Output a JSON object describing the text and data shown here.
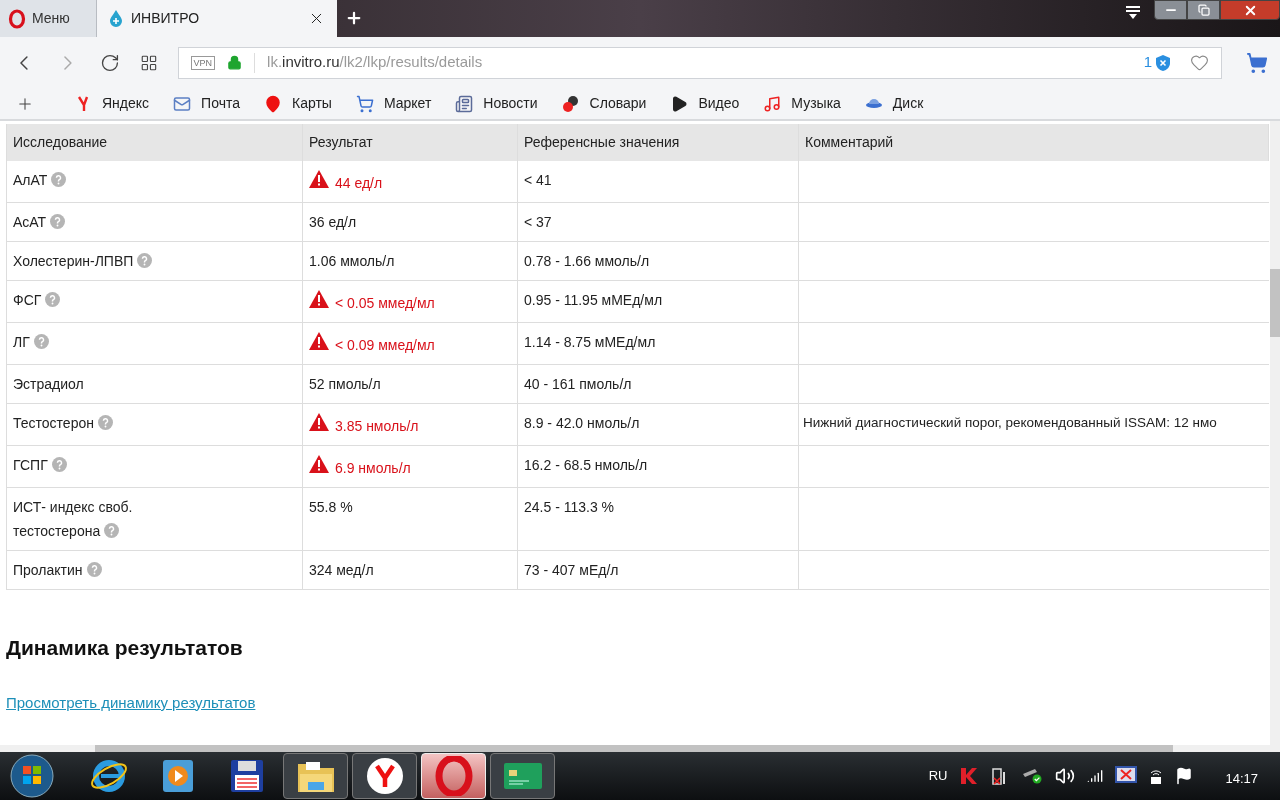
{
  "browser": {
    "menu_label": "Меню",
    "tabs": [
      {
        "title": "ИНВИТРО",
        "selected": true
      }
    ],
    "url": {
      "prefix": "lk.",
      "host": "invitro.ru",
      "path": "/lk2/lkp/results/details"
    },
    "vpn_label": "VPN",
    "tracker_count": "1",
    "bookmarks": [
      {
        "label": "Яндекс",
        "kind": "ya"
      },
      {
        "label": "Почта",
        "kind": "mail"
      },
      {
        "label": "Карты",
        "kind": "pin"
      },
      {
        "label": "Маркет",
        "kind": "cart"
      },
      {
        "label": "Новости",
        "kind": "news"
      },
      {
        "label": "Словари",
        "kind": "dict"
      },
      {
        "label": "Видео",
        "kind": "video"
      },
      {
        "label": "Музыка",
        "kind": "music"
      },
      {
        "label": "Диск",
        "kind": "disk"
      }
    ]
  },
  "table": {
    "columns": [
      "Исследование",
      "Результат",
      "Референсные значения",
      "Комментарий"
    ],
    "rows": [
      {
        "name": "АлАТ",
        "help": true,
        "result": "44 ед/л",
        "abnormal": true,
        "reference": "< 41"
      },
      {
        "name": "АсАТ",
        "help": true,
        "result": "36 ед/л",
        "abnormal": false,
        "reference": "< 37"
      },
      {
        "name": "Холестерин-ЛПВП",
        "help": true,
        "result": "1.06 ммоль/л",
        "abnormal": false,
        "reference": "0.78 - 1.66 ммоль/л"
      },
      {
        "name": "ФСГ",
        "help": true,
        "result": "< 0.05 ммед/мл",
        "abnormal": true,
        "reference": "0.95 - 11.95 мМЕд/мл"
      },
      {
        "name": "ЛГ",
        "help": true,
        "result": "< 0.09 ммед/мл",
        "abnormal": true,
        "reference": "1.14 - 8.75 мМЕд/мл"
      },
      {
        "name": "Эстрадиол",
        "help": false,
        "result": "52 пмоль/л",
        "abnormal": false,
        "reference": "40 - 161 пмоль/л"
      },
      {
        "name": "Тестостерон",
        "help": true,
        "result": "3.85 нмоль/л",
        "abnormal": true,
        "reference": "8.9 - 42.0 нмоль/л",
        "comment": "Нижний диагностический порог, рекомендованный ISSAM: 12 нмо"
      },
      {
        "name": "ГСПГ",
        "help": true,
        "result": "6.9 нмоль/л",
        "abnormal": true,
        "reference": "16.2 - 68.5 нмоль/л"
      },
      {
        "name": "ИСТ- индекс своб. тестостерона",
        "help": true,
        "result": "55.8 %",
        "abnormal": false,
        "reference": "24.5 - 113.3 %"
      },
      {
        "name": "Пролактин",
        "help": true,
        "result": "324 мед/л",
        "abnormal": false,
        "reference": "73 - 407 мЕд/л"
      }
    ]
  },
  "dynamics": {
    "heading": "Динамика результатов",
    "link": "Просмотреть динамику результатов"
  },
  "taskbar": {
    "apps": [
      {
        "kind": "ie",
        "selected": false
      },
      {
        "kind": "media",
        "selected": false
      },
      {
        "kind": "save",
        "selected": false
      },
      {
        "kind": "folder",
        "selected": false
      },
      {
        "kind": "yandex",
        "selected": false
      },
      {
        "kind": "opera",
        "selected": true
      },
      {
        "kind": "card",
        "selected": false
      }
    ],
    "language": "RU",
    "time": "14:17"
  }
}
